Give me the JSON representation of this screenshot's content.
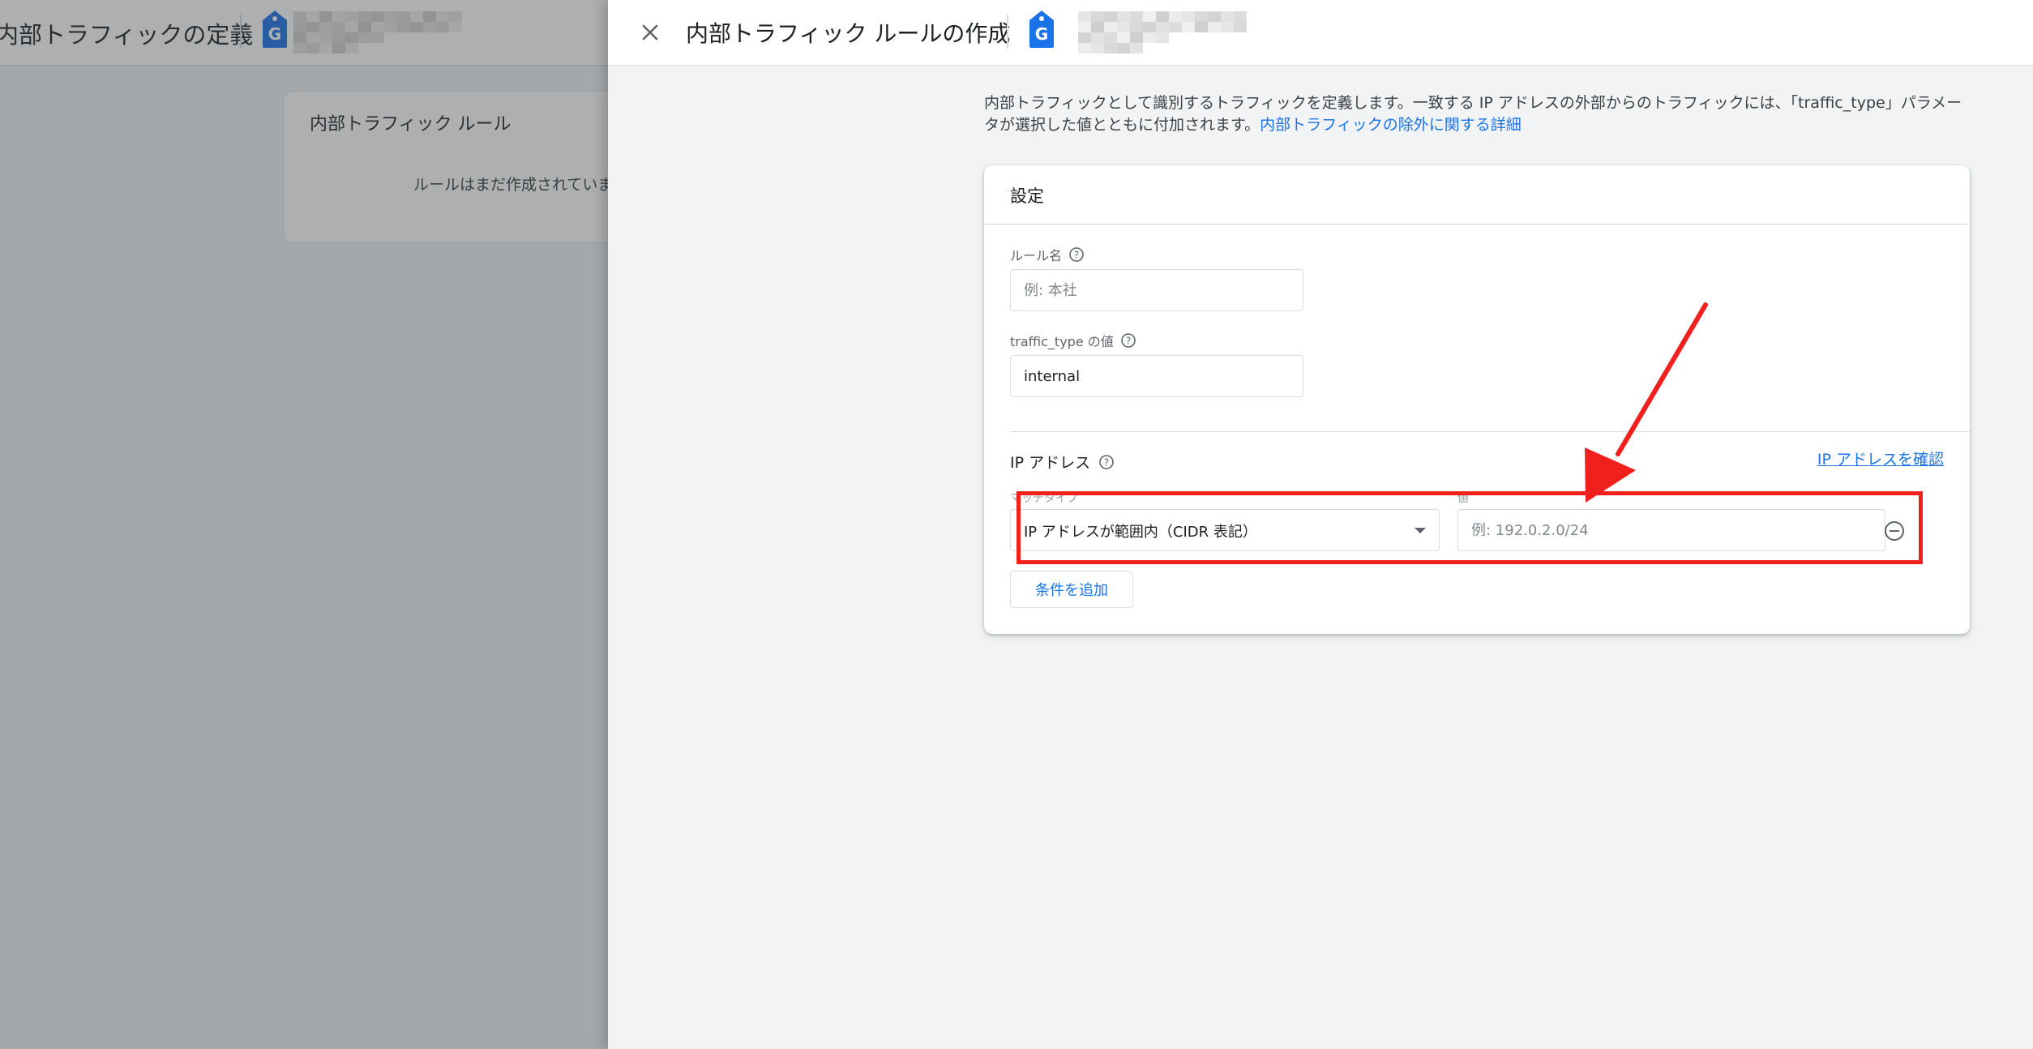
{
  "background_page": {
    "title": "内部トラフィックの定義",
    "card_title": "内部トラフィック ルール",
    "empty_text": "ルールはまだ作成されていま"
  },
  "panel": {
    "title": "内部トラフィック ルールの作成",
    "description": {
      "line1": "内部トラフィックとして識別するトラフィックを定義します。一致する IP アドレスの外部からのトラフィックには、「traffic_type」パラメー",
      "line2_text": "タが選択した値とともに付加されます。",
      "line2_link": "内部トラフィックの除外に関する詳細"
    },
    "settings_card": {
      "title": "設定",
      "rule_name": {
        "label": "ルール名",
        "placeholder": "例: 本社",
        "value": ""
      },
      "traffic_type": {
        "label": "traffic_type の値",
        "value": "internal"
      },
      "ip_section": {
        "title": "IP アドレス",
        "verify_link": "IP アドレスを確認",
        "match_type_label": "マッチタイプ",
        "match_type_value": "IP アドレスが範囲内（CIDR 表記）",
        "value_label": "値",
        "value_placeholder": "例: 192.0.2.0/24"
      },
      "add_condition_label": "条件を追加"
    }
  },
  "colors": {
    "accent_blue": "#1a73e8",
    "annotation_red": "#f0201c",
    "tag_blue": "#1a73e8"
  },
  "icons": [
    "close-icon",
    "google-tag-icon",
    "help-icon",
    "dropdown-arrow-icon",
    "remove-circle-icon",
    "annotation-arrow"
  ]
}
